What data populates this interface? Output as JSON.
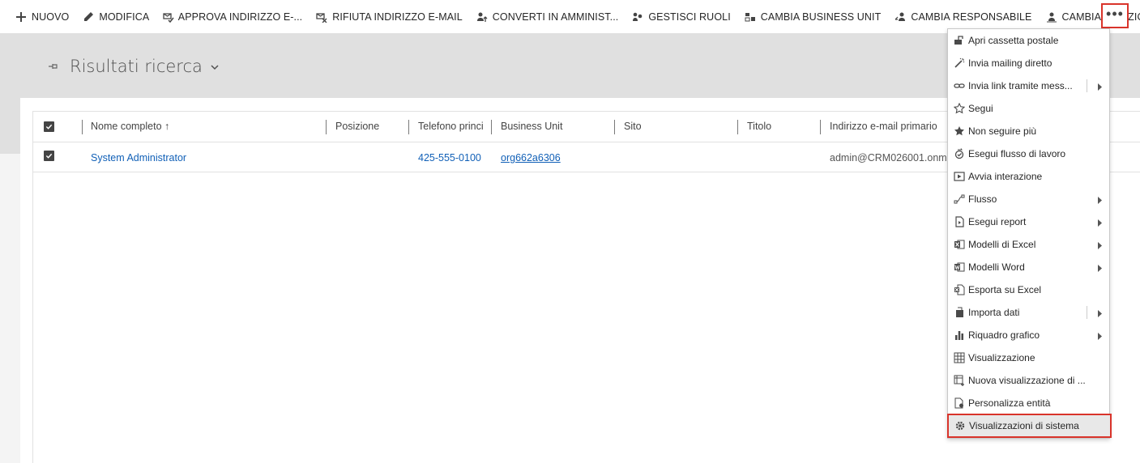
{
  "toolbar": {
    "items": [
      {
        "label": "NUOVO",
        "icon": "plus-icon"
      },
      {
        "label": "MODIFICA",
        "icon": "pencil-icon"
      },
      {
        "label": "APPROVA INDIRIZZO E-...",
        "icon": "approve-email-icon"
      },
      {
        "label": "RIFIUTA INDIRIZZO E-MAIL",
        "icon": "reject-email-icon"
      },
      {
        "label": "CONVERTI IN AMMINIST...",
        "icon": "convert-user-icon"
      },
      {
        "label": "GESTISCI RUOLI",
        "icon": "manage-roles-icon"
      },
      {
        "label": "CAMBIA BUSINESS UNIT",
        "icon": "business-unit-icon"
      },
      {
        "label": "CAMBIA RESPONSABILE",
        "icon": "change-manager-icon"
      },
      {
        "label": "CAMBIA POSIZIONE",
        "icon": "change-position-icon"
      }
    ],
    "more_label": "•••"
  },
  "view": {
    "title": "Risultati ricerca"
  },
  "grid": {
    "columns": [
      "Nome completo",
      "Posizione",
      "Telefono princi",
      "Business Unit",
      "Sito",
      "Titolo",
      "Indirizzo e-mail primario"
    ],
    "sort_indicator": "↑",
    "rows": [
      {
        "name": "System Administrator",
        "position": "",
        "phone": "425-555-0100",
        "business_unit": "org662a6306",
        "site": "",
        "title": "",
        "email": "admin@CRM026001.onm"
      }
    ]
  },
  "menu": {
    "items": [
      {
        "label": "Apri cassetta postale",
        "icon": "mailbox-icon",
        "submenu": false
      },
      {
        "label": "Invia mailing diretto",
        "icon": "magic-wand-icon",
        "submenu": false
      },
      {
        "label": "Invia link tramite mess...",
        "icon": "link-icon",
        "submenu": true
      },
      {
        "label": "Segui",
        "icon": "star-outline-icon",
        "submenu": false
      },
      {
        "label": "Non seguire più",
        "icon": "star-filled-icon",
        "submenu": false
      },
      {
        "label": "Esegui flusso di lavoro",
        "icon": "workflow-icon",
        "submenu": false
      },
      {
        "label": "Avvia interazione",
        "icon": "play-icon",
        "submenu": false
      },
      {
        "label": "Flusso",
        "icon": "flow-icon",
        "submenu": true
      },
      {
        "label": "Esegui report",
        "icon": "report-icon",
        "submenu": true
      },
      {
        "label": "Modelli di Excel",
        "icon": "excel-icon",
        "submenu": true
      },
      {
        "label": "Modelli Word",
        "icon": "word-icon",
        "submenu": true
      },
      {
        "label": "Esporta su Excel",
        "icon": "export-excel-icon",
        "submenu": false
      },
      {
        "label": "Importa dati",
        "icon": "import-icon",
        "submenu": true
      },
      {
        "label": "Riquadro grafico",
        "icon": "bar-chart-icon",
        "submenu": true
      },
      {
        "label": "Visualizzazione",
        "icon": "grid-view-icon",
        "submenu": false
      },
      {
        "label": "Nuova visualizzazione di ...",
        "icon": "new-view-icon",
        "submenu": false
      },
      {
        "label": "Personalizza entità",
        "icon": "customize-icon",
        "submenu": false
      },
      {
        "label": "Visualizzazioni di sistema",
        "icon": "gear-icon",
        "submenu": false
      }
    ]
  },
  "colors": {
    "highlight_border": "#d9342b",
    "link": "#1160b7",
    "header_band": "#e0e0e0"
  }
}
